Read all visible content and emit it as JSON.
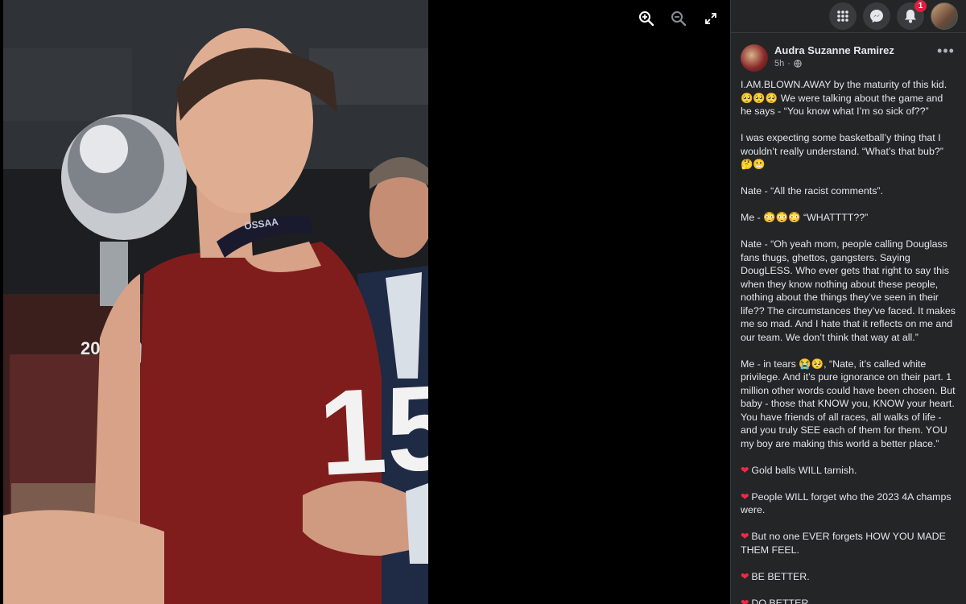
{
  "viewer": {
    "zoom_in_icon": "magnifier-plus-icon",
    "zoom_out_icon": "magnifier-minus-icon",
    "fullscreen_icon": "expand-arrows-icon",
    "photo": {
      "alt": "Basketball player in red jersey number 15 holding a trophy",
      "jersey_number": "15",
      "trophy_plate": "20",
      "lanyard_text": "OSSAA"
    }
  },
  "topbar": {
    "menu_icon": "grid-menu-icon",
    "messenger_icon": "messenger-icon",
    "notifications_icon": "bell-icon",
    "notifications_count": "1",
    "profile_icon": "account-avatar"
  },
  "post": {
    "author": "Audra Suzanne Ramirez",
    "time": "5h",
    "privacy_icon": "globe-icon",
    "more_icon": "ellipsis-icon",
    "paragraphs": [
      "I.AM.BLOWN.AWAY by the maturity of this kid. 🥺🥺🥺 We were talking about the game and he says - “You know what I’m so sick of??”",
      "I was expecting some basketball’y thing that I wouldn’t really understand. “What’s that bub?” 🤔😬",
      "Nate - “All the racist comments”.",
      "Me - 😳😳😳 “WHATTTT??”",
      "Nate - “Oh yeah mom, people calling Douglass fans thugs, ghettos, gangsters. Saying DougLESS. Who ever gets that right to say this when they know nothing about these people, nothing about the things they’ve seen in their life?? The circumstances they’ve faced. It makes me so mad. And I hate that it reflects on me and our team. We don’t think that way at all.”",
      "Me - in tears 😭🥺, “Nate, it’s called white privilege. And it’s pure ignorance on their part. 1 million other words could have been chosen. But baby - those that KNOW you, KNOW your heart. You have friends of all races, all walks of life - and you truly SEE each of them for them. YOU my boy are making this world a better place.”"
    ],
    "heart_lines": [
      "Gold balls WILL tarnish.",
      "People WILL forget who the 2023 4A champs were.",
      "But no one EVER forgets HOW YOU MADE THEM FEEL.",
      "BE BETTER.",
      "DO BETTER."
    ],
    "heart_symbol": "❤"
  }
}
